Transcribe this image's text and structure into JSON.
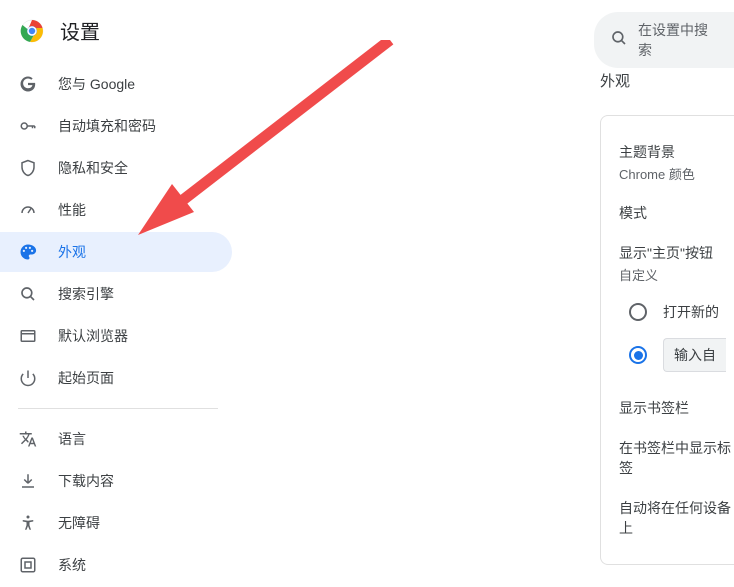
{
  "header": {
    "title": "设置"
  },
  "search": {
    "placeholder": "在设置中搜索"
  },
  "sidebar": {
    "items": [
      {
        "label": "您与 Google"
      },
      {
        "label": "自动填充和密码"
      },
      {
        "label": "隐私和安全"
      },
      {
        "label": "性能"
      },
      {
        "label": "外观"
      },
      {
        "label": "搜索引擎"
      },
      {
        "label": "默认浏览器"
      },
      {
        "label": "起始页面"
      }
    ],
    "items2": [
      {
        "label": "语言"
      },
      {
        "label": "下载内容"
      },
      {
        "label": "无障碍"
      },
      {
        "label": "系统"
      }
    ]
  },
  "content": {
    "section_title": "外观",
    "theme_label": "主题背景",
    "theme_value": "Chrome 颜色",
    "mode_label": "模式",
    "home_button_label": "显示\"主页\"按钮",
    "home_button_sub": "自定义",
    "radio_newtab": "打开新的",
    "radio_custom": "输入自",
    "bookmarks_bar": "显示书签栏",
    "tab_labels": "在书签栏中显示标签",
    "auto_device": "自动将在任何设备上"
  }
}
